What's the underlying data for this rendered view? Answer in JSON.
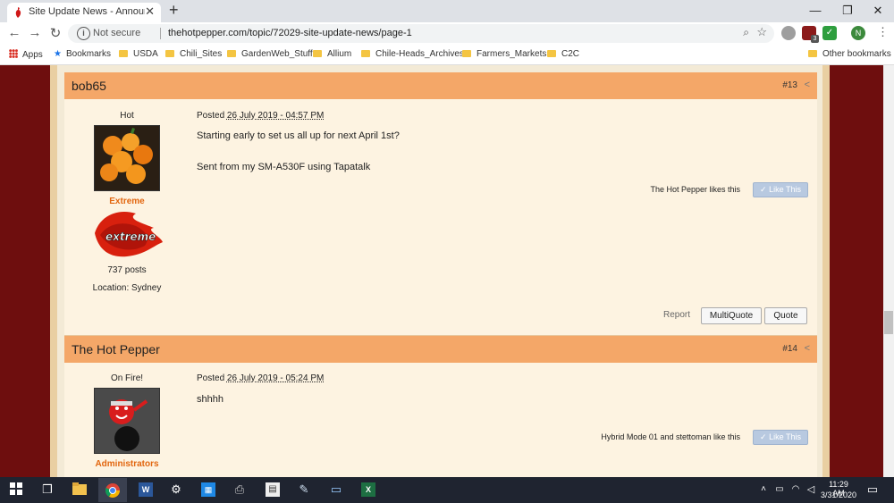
{
  "browser": {
    "tab_title": "Site Update News - Announceme",
    "tab_close": "✕",
    "new_tab": "+",
    "window_buttons": {
      "minimize": "—",
      "restore": "❐",
      "close": "✕"
    },
    "not_secure": "Not secure",
    "url": "thehotpepper.com/topic/72029-site-update-news/page-1",
    "extension_badge": "3",
    "profile_initial": "N",
    "bookmarks": {
      "apps": "Apps",
      "items": [
        "Bookmarks",
        "USDA",
        "Chili_Sites",
        "GardenWeb_Stuff",
        "Allium",
        "Chile-Heads_Archives",
        "Farmers_Markets",
        "C2C"
      ],
      "other": "Other bookmarks"
    }
  },
  "posts": [
    {
      "author": "bob65",
      "number": "#13",
      "rank": "Hot",
      "group": "Extreme",
      "badge_text": "extreme",
      "post_count": "737 posts",
      "location": "Location: Sydney",
      "posted_label": "Posted",
      "posted_date": "26 July 2019 - 04:57 PM",
      "lines": [
        "Starting early to set us all up for next April 1st?",
        "Sent from my SM-A530F using Tapatalk"
      ],
      "likes_text": "The Hot Pepper likes this",
      "like_button": "Like This",
      "report": "Report",
      "multiquote": "MultiQuote",
      "quote": "Quote"
    },
    {
      "author": "The Hot Pepper",
      "number": "#14",
      "rank": "On Fire!",
      "group": "Administrators",
      "posted_label": "Posted",
      "posted_date": "26 July 2019 - 05:24 PM",
      "lines": [
        "shhhh"
      ],
      "likes_text": "Hybrid Mode 01 and stettoman like this",
      "like_button": "Like This"
    }
  ],
  "taskbar": {
    "time": "11:29 AM",
    "date": "3/31/2020"
  },
  "colors": {
    "page_bg": "#6e0e0e",
    "post_header": "#f4a768",
    "post_body": "#fdf3e1",
    "group_extreme": "#e2660f"
  }
}
